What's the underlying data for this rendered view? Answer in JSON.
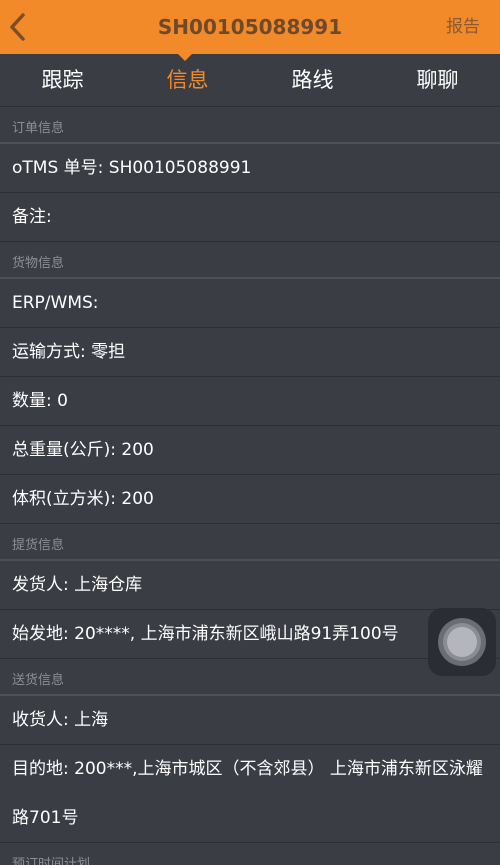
{
  "header": {
    "title": "SH00105088991",
    "report_label": "报告",
    "back_icon": "chevron-left-icon"
  },
  "tabs": [
    {
      "label": "跟踪",
      "active": false
    },
    {
      "label": "信息",
      "active": true
    },
    {
      "label": "路线",
      "active": false
    },
    {
      "label": "聊聊",
      "active": false
    }
  ],
  "sections": {
    "order_info": {
      "title": "订单信息",
      "otms_no": "oTMS 单号: SH00105088991",
      "remark": "备注:"
    },
    "cargo_info": {
      "title": "货物信息",
      "erp_wms": "ERP/WMS:",
      "transport_mode": "运输方式: 零担",
      "quantity": "数量: 0",
      "total_weight": "总重量(公斤): 200",
      "volume": "体积(立方米): 200"
    },
    "pickup_info": {
      "title": "提货信息",
      "shipper": "发货人: 上海仓库",
      "origin": "始发地: 20****, 上海市浦东新区峨山路91弄100号"
    },
    "delivery_info": {
      "title": "送货信息",
      "consignee": "收货人: 上海",
      "destination": "目的地: 200***,上海市城区（不含郊县） 上海市浦东新区泳耀路701号"
    },
    "schedule": {
      "title": "预订时间计划"
    }
  },
  "colors": {
    "accent": "#f28a2a",
    "background": "#3a3d44",
    "text": "#ffffff",
    "section_text": "#8c8f96"
  }
}
